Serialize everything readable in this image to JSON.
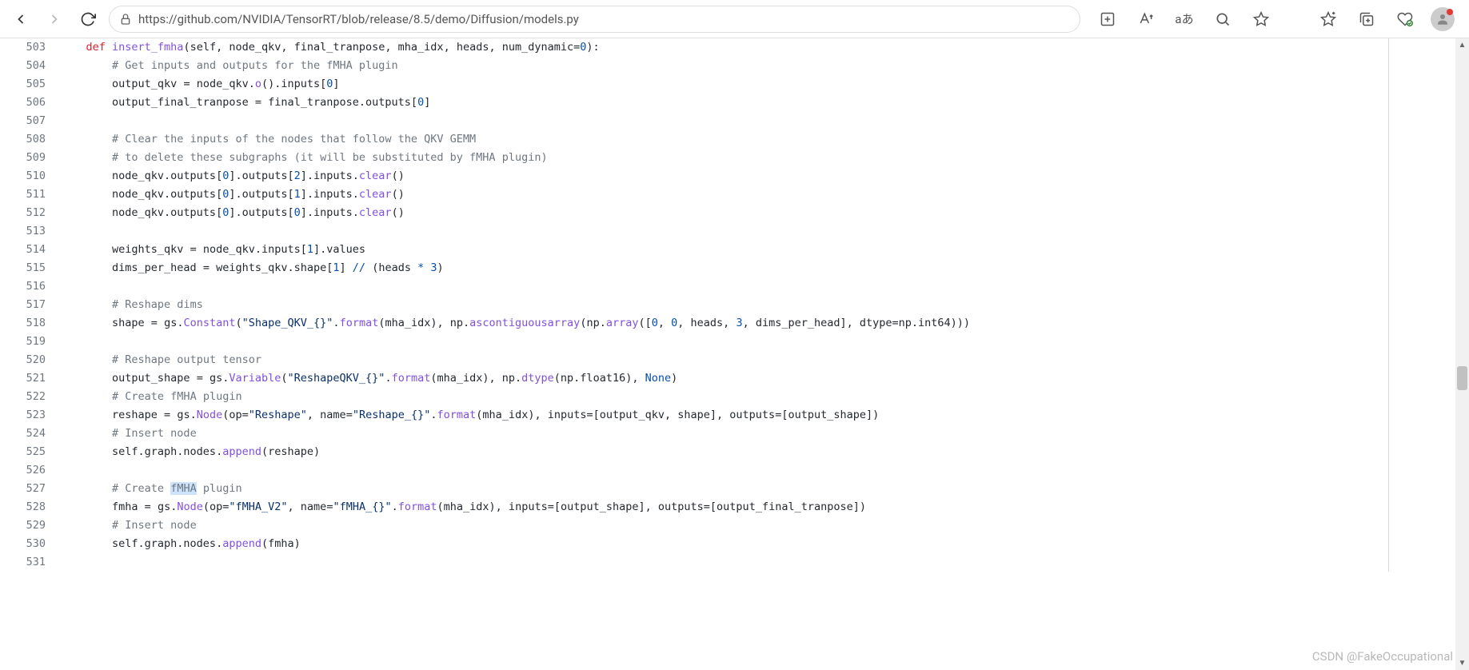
{
  "url": "https://github.com/NVIDIA/TensorRT/blob/release/8.5/demo/Diffusion/models.py",
  "watermark": "CSDN @FakeOccupational",
  "line_start": 503,
  "code_lines": [
    {
      "n": 503,
      "segs": [
        [
          "    ",
          ""
        ],
        [
          "def ",
          "kw"
        ],
        [
          "insert_fmha",
          "fn"
        ],
        [
          "(",
          ""
        ],
        [
          "self",
          ""
        ],
        [
          ", node_qkv, final_tranpose, mha_idx, heads, num_dynamic",
          ""
        ],
        [
          "=",
          ""
        ],
        [
          "0",
          "num"
        ],
        [
          "):",
          ""
        ]
      ]
    },
    {
      "n": 504,
      "segs": [
        [
          "        ",
          ""
        ],
        [
          "# Get inputs and outputs for the fMHA plugin",
          "cm"
        ]
      ]
    },
    {
      "n": 505,
      "segs": [
        [
          "        output_qkv ",
          ""
        ],
        [
          "=",
          ""
        ],
        [
          " node_qkv.",
          ""
        ],
        [
          "o",
          "fn"
        ],
        [
          "().inputs[",
          ""
        ],
        [
          "0",
          "num"
        ],
        [
          ")",
          ""
        ],
        [
          "",
          ""
        ],
        [
          "]",
          ""
        ]
      ],
      "raw": "        output_qkv = node_qkv.o().inputs[0]"
    },
    {
      "n": 506,
      "segs": [
        [
          "        output_final_tranpose ",
          ""
        ],
        [
          "=",
          ""
        ],
        [
          " final_tranpose.outputs[",
          ""
        ],
        [
          "0",
          "num"
        ],
        [
          "]",
          ""
        ]
      ]
    },
    {
      "n": 507,
      "segs": [
        [
          "",
          ""
        ]
      ]
    },
    {
      "n": 508,
      "segs": [
        [
          "        ",
          ""
        ],
        [
          "# Clear the inputs of the nodes that follow the QKV GEMM",
          "cm"
        ]
      ]
    },
    {
      "n": 509,
      "segs": [
        [
          "        ",
          ""
        ],
        [
          "# to delete these subgraphs (it will be substituted by fMHA plugin)",
          "cm"
        ]
      ]
    },
    {
      "n": 510,
      "segs": [
        [
          "        node_qkv.outputs[",
          ""
        ],
        [
          "0",
          "num"
        ],
        [
          "].outputs[",
          ""
        ],
        [
          "2",
          "num"
        ],
        [
          "].inputs.",
          ""
        ],
        [
          "clear",
          "fn"
        ],
        [
          "()",
          ""
        ]
      ]
    },
    {
      "n": 511,
      "segs": [
        [
          "        node_qkv.outputs[",
          ""
        ],
        [
          "0",
          "num"
        ],
        [
          "].outputs[",
          ""
        ],
        [
          "1",
          "num"
        ],
        [
          "].inputs.",
          ""
        ],
        [
          "clear",
          "fn"
        ],
        [
          "()",
          ""
        ]
      ]
    },
    {
      "n": 512,
      "segs": [
        [
          "        node_qkv.outputs[",
          ""
        ],
        [
          "0",
          "num"
        ],
        [
          "].outputs[",
          ""
        ],
        [
          "0",
          "num"
        ],
        [
          "].inputs.",
          ""
        ],
        [
          "clear",
          "fn"
        ],
        [
          "()",
          ""
        ]
      ]
    },
    {
      "n": 513,
      "segs": [
        [
          "",
          ""
        ]
      ]
    },
    {
      "n": 514,
      "segs": [
        [
          "        weights_qkv ",
          ""
        ],
        [
          "=",
          ""
        ],
        [
          " node_qkv.inputs[",
          ""
        ],
        [
          "1",
          "num"
        ],
        [
          "].values",
          ""
        ]
      ]
    },
    {
      "n": 515,
      "segs": [
        [
          "        dims_per_head ",
          ""
        ],
        [
          "=",
          ""
        ],
        [
          " weights_qkv.shape[",
          ""
        ],
        [
          "1",
          "num"
        ],
        [
          "] ",
          ""
        ],
        [
          "// ",
          "op"
        ],
        [
          "(heads ",
          ""
        ],
        [
          "*",
          "op"
        ],
        [
          " ",
          ""
        ],
        [
          "3",
          "num"
        ],
        [
          ")",
          ""
        ]
      ]
    },
    {
      "n": 516,
      "segs": [
        [
          "",
          ""
        ]
      ]
    },
    {
      "n": 517,
      "segs": [
        [
          "        ",
          ""
        ],
        [
          "# Reshape dims",
          "cm"
        ]
      ]
    },
    {
      "n": 518,
      "segs": [
        [
          "        shape ",
          ""
        ],
        [
          "=",
          ""
        ],
        [
          " gs.",
          ""
        ],
        [
          "Constant",
          "fn"
        ],
        [
          "(",
          ""
        ],
        [
          "\"Shape_QKV_{}\"",
          "str"
        ],
        [
          ".",
          ""
        ],
        [
          "format",
          "fn"
        ],
        [
          "(mha_idx), np.",
          ""
        ],
        [
          "ascontiguousarray",
          "fn"
        ],
        [
          "(np.",
          ""
        ],
        [
          "array",
          "fn"
        ],
        [
          "([",
          ""
        ],
        [
          "0",
          "num"
        ],
        [
          ", ",
          ""
        ],
        [
          "0",
          "num"
        ],
        [
          ", heads, ",
          ""
        ],
        [
          "3",
          "num"
        ],
        [
          ", dims_per_head], dtype",
          ""
        ],
        [
          "=",
          ""
        ],
        [
          "np.int64)))",
          ""
        ]
      ]
    },
    {
      "n": 519,
      "segs": [
        [
          "",
          ""
        ]
      ]
    },
    {
      "n": 520,
      "segs": [
        [
          "        ",
          ""
        ],
        [
          "# Reshape output tensor",
          "cm"
        ]
      ]
    },
    {
      "n": 521,
      "segs": [
        [
          "        output_shape ",
          ""
        ],
        [
          "=",
          ""
        ],
        [
          " gs.",
          ""
        ],
        [
          "Variable",
          "fn"
        ],
        [
          "(",
          ""
        ],
        [
          "\"ReshapeQKV_{}\"",
          "str"
        ],
        [
          ".",
          ""
        ],
        [
          "format",
          "fn"
        ],
        [
          "(mha_idx), np.",
          ""
        ],
        [
          "dtype",
          "fn"
        ],
        [
          "(np.float16), ",
          ""
        ],
        [
          "None",
          "num"
        ],
        [
          ")",
          ""
        ]
      ]
    },
    {
      "n": 522,
      "segs": [
        [
          "        ",
          ""
        ],
        [
          "# Create fMHA plugin",
          "cm"
        ]
      ]
    },
    {
      "n": 523,
      "segs": [
        [
          "        reshape ",
          ""
        ],
        [
          "=",
          ""
        ],
        [
          " gs.",
          ""
        ],
        [
          "Node",
          "fn"
        ],
        [
          "(op",
          ""
        ],
        [
          "=",
          ""
        ],
        [
          "\"Reshape\"",
          "str"
        ],
        [
          ", name",
          ""
        ],
        [
          "=",
          ""
        ],
        [
          "\"Reshape_{}\"",
          "str"
        ],
        [
          ".",
          ""
        ],
        [
          "format",
          "fn"
        ],
        [
          "(mha_idx), inputs",
          ""
        ],
        [
          "=",
          ""
        ],
        [
          "[output_qkv, shape], outputs",
          ""
        ],
        [
          "=",
          ""
        ],
        [
          "[output_shape])",
          ""
        ]
      ]
    },
    {
      "n": 524,
      "segs": [
        [
          "        ",
          ""
        ],
        [
          "# Insert node",
          "cm"
        ]
      ]
    },
    {
      "n": 525,
      "segs": [
        [
          "        self.graph.nodes.",
          ""
        ],
        [
          "append",
          "fn"
        ],
        [
          "(reshape)",
          ""
        ]
      ]
    },
    {
      "n": 526,
      "segs": [
        [
          "",
          ""
        ]
      ]
    },
    {
      "n": 527,
      "segs": [
        [
          "        ",
          ""
        ],
        [
          "# Create ",
          "cm"
        ],
        [
          "fMHA",
          "cm hl"
        ],
        [
          " plugin",
          "cm"
        ]
      ]
    },
    {
      "n": 528,
      "segs": [
        [
          "        fmha ",
          ""
        ],
        [
          "=",
          ""
        ],
        [
          " gs.",
          ""
        ],
        [
          "Node",
          "fn"
        ],
        [
          "(op",
          ""
        ],
        [
          "=",
          ""
        ],
        [
          "\"fMHA_V2\"",
          "str"
        ],
        [
          ", name",
          ""
        ],
        [
          "=",
          ""
        ],
        [
          "\"fMHA_{}\"",
          "str"
        ],
        [
          ".",
          ""
        ],
        [
          "format",
          "fn"
        ],
        [
          "(mha_idx), inputs",
          ""
        ],
        [
          "=",
          ""
        ],
        [
          "[output_shape], outputs",
          ""
        ],
        [
          "=",
          ""
        ],
        [
          "[output_final_tranpose])",
          ""
        ]
      ]
    },
    {
      "n": 529,
      "segs": [
        [
          "        ",
          ""
        ],
        [
          "# Insert node",
          "cm"
        ]
      ]
    },
    {
      "n": 530,
      "segs": [
        [
          "        self.graph.nodes.",
          ""
        ],
        [
          "append",
          "fn"
        ],
        [
          "(fmha)",
          ""
        ]
      ]
    },
    {
      "n": 531,
      "segs": [
        [
          "",
          ""
        ]
      ]
    }
  ]
}
